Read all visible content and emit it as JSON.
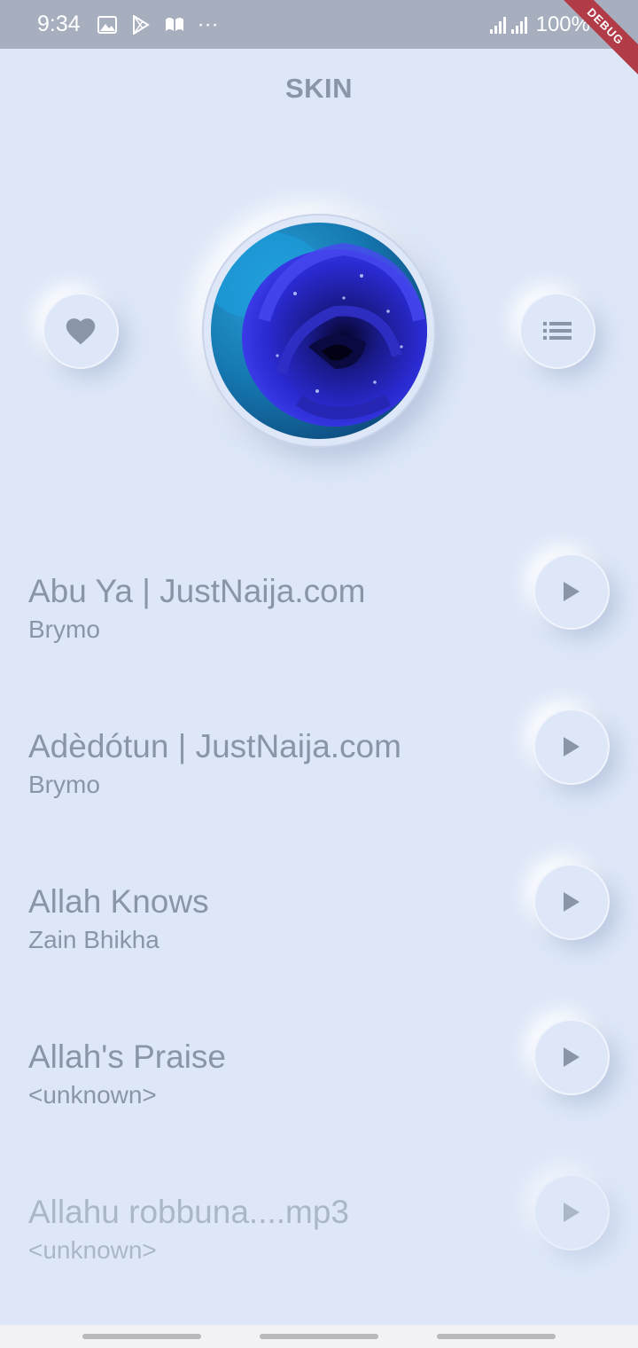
{
  "status_bar": {
    "time": "9:34",
    "dots": "···",
    "battery": "100%",
    "debug_banner": "DEBUG"
  },
  "header": {
    "title": "SKIN"
  },
  "colors": {
    "background": "#dde7f8",
    "text": "#8a96a8",
    "status_bar": "#a7afbf",
    "debug_ribbon": "#b23b48"
  },
  "now_playing": {
    "favorite_icon": "heart-icon",
    "playlist_icon": "list-icon",
    "album_art": "blue-rose-image"
  },
  "songs": [
    {
      "title": "Abu Ya | JustNaija.com",
      "artist": "Brymo"
    },
    {
      "title": "Adèdótun | JustNaija.com",
      "artist": "Brymo"
    },
    {
      "title": "Allah Knows",
      "artist": "Zain Bhikha"
    },
    {
      "title": "Allah's Praise",
      "artist": "<unknown>"
    },
    {
      "title": "Allahu robbuna....mp3",
      "artist": "<unknown>"
    }
  ]
}
